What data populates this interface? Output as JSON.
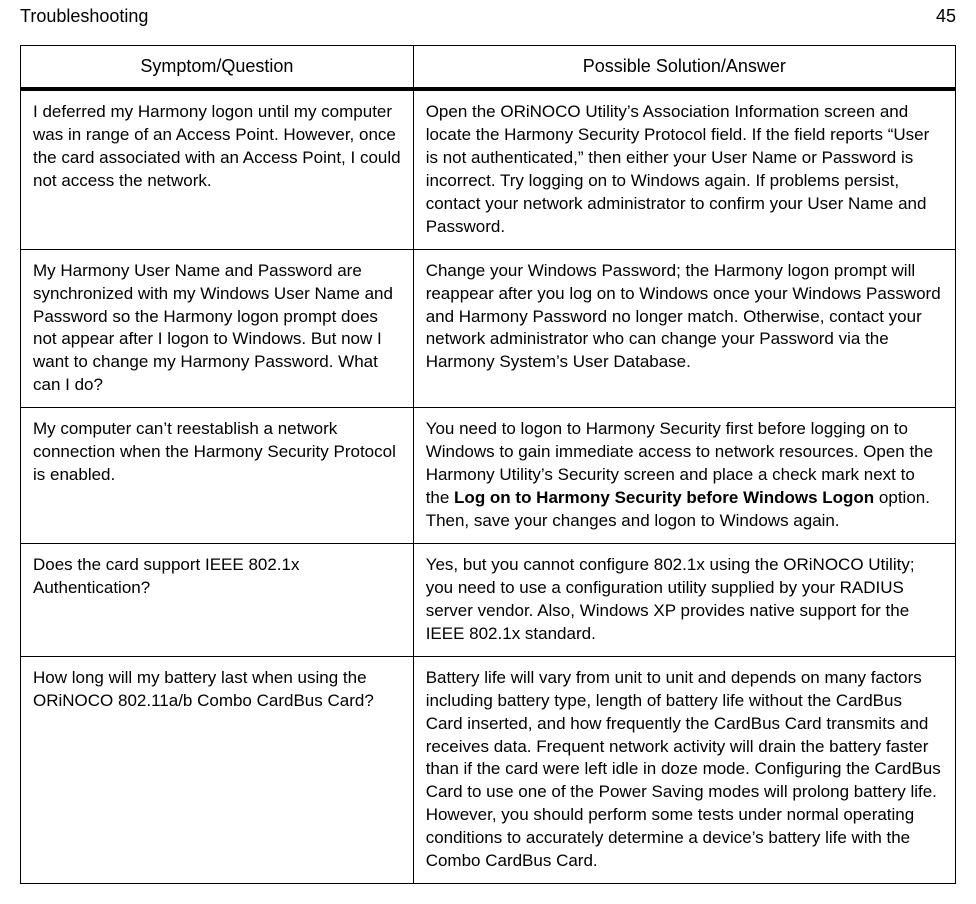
{
  "header": {
    "section_title": "Troubleshooting",
    "page_number": "45"
  },
  "table": {
    "headers": {
      "symptom": "Symptom/Question",
      "solution": "Possible Solution/Answer"
    },
    "rows": [
      {
        "symptom": "I deferred my Harmony logon until my computer was in range of an Access Point. However, once the card associated with an Access Point, I could not access the network.",
        "solution": "Open the ORiNOCO Utility’s Association Information screen and locate the Harmony Security Protocol field. If the field reports “User is not authenticated,” then either your User Name or Password is incorrect. Try logging on to Windows again. If problems persist, contact your network administrator to confirm your User Name and Password."
      },
      {
        "symptom": "My Harmony User Name and Password are synchronized with my Windows User Name and Password so the Harmony logon prompt does not appear after I logon to Windows. But now I want to change my Harmony Password. What can I do?",
        "solution": "Change your Windows Password; the Harmony logon prompt will reappear after you log on to Windows once your Windows Password and Harmony Password no longer match. Otherwise, contact your network administrator who can change your Password via the Harmony System’s User Database."
      },
      {
        "symptom": "My computer can’t reestablish a network connection when the Harmony Security Protocol is enabled.",
        "solution_pre": "You need to logon to Harmony Security first before logging on to Windows to gain immediate access to network resources. Open the Harmony Utility’s Security screen and place a check mark next to the ",
        "solution_bold": "Log on to Harmony Security before Windows Logon",
        "solution_post": " option. Then, save your changes and logon to Windows again."
      },
      {
        "symptom": "Does the card support IEEE 802.1x Authentication?",
        "solution": "Yes, but you cannot configure 802.1x using the ORiNOCO Utility; you need to use a configuration utility supplied by your RADIUS server vendor. Also, Windows XP provides native support for the IEEE 802.1x standard."
      },
      {
        "symptom": "How long will my battery last when using the ORiNOCO 802.11a/b Combo CardBus Card?",
        "solution": "Battery life will vary from unit to unit and depends on many factors including battery type, length of battery life without the CardBus Card inserted, and how frequently the CardBus Card transmits and receives data. Frequent network activity will drain the battery faster than if the card were left idle in doze mode. Configuring the CardBus Card to use one of the Power Saving modes will prolong battery life. However, you should perform some tests under normal operating conditions to accurately determine a device’s battery life with the Combo CardBus Card."
      }
    ]
  }
}
